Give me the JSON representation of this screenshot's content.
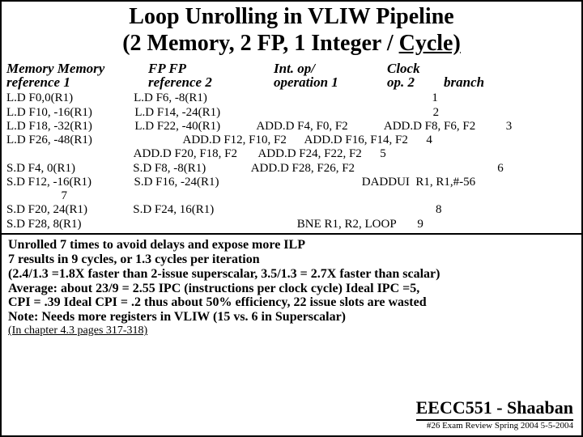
{
  "title": "Loop Unrolling in VLIW Pipeline",
  "subtitle_plain": "(2 Memory, 2 FP, 1 Integer / ",
  "subtitle_ul": "Cycle)",
  "headers": {
    "c1a": "Memory  Memory",
    "c1b": "reference 1",
    "c2a": "FP            FP",
    "c2b": "reference 2",
    "c3a": "Int. op/",
    "c3b": "operation 1",
    "c4a": "Clock",
    "c4b": "op. 2",
    "c5a": "",
    "c5b": "branch"
  },
  "rows": [
    "L.D F0,0(R1)                    L.D F6, -8(R1)                                                                          1",
    "L.D F10, -16(R1)              L.D F14, -24(R1)                                                                      2",
    "L.D F18, -32(R1)              L.D F22, -40(R1)            ADD.D F4, F0, F2            ADD.D F8, F6, F2          3",
    "L.D F26, -48(R1)                              ADD.D F12, F10, F2      ADD.D F16, F14, F2      4",
    "                                          ADD.D F20, F18, F2       ADD.D F24, F22, F2      5",
    "S.D F4, 0(R1)                   S.D F8, -8(R1)               ADD.D F28, F26, F2                                               6",
    "S.D F12, -16(R1)              S.D F16, -24(R1)                                               DADDUI  R1, R1,#-56",
    "                  7",
    "S.D F20, 24(R1)               S.D F24, 16(R1)                                                                         8",
    "S.D F28, 8(R1)                                                                       BNE R1, R2, LOOP       9"
  ],
  "notes": [
    "  Unrolled 7 times to avoid delays and expose more ILP",
    "  7 results in 9 cycles, or 1.3 cycles per iteration",
    "(2.4/1.3 =1.8X faster than 2-issue superscalar,  3.5/1.3 = 2.7X faster than scalar)",
    "Average: about 23/9 = 2.55 IPC  (instructions per clock cycle)  Ideal IPC =5,",
    "  CPI = .39  Ideal CPI = .2  thus about 50% efficiency, 22 issue slots are wasted",
    "  Note: Needs more registers in VLIW (15 vs. 6 in Superscalar)"
  ],
  "chapter": "(In chapter 4.3 pages 317-318)",
  "course": "EECC551 - Shaaban",
  "pagefoot": "#26   Exam Review  Spring 2004  5-5-2004"
}
